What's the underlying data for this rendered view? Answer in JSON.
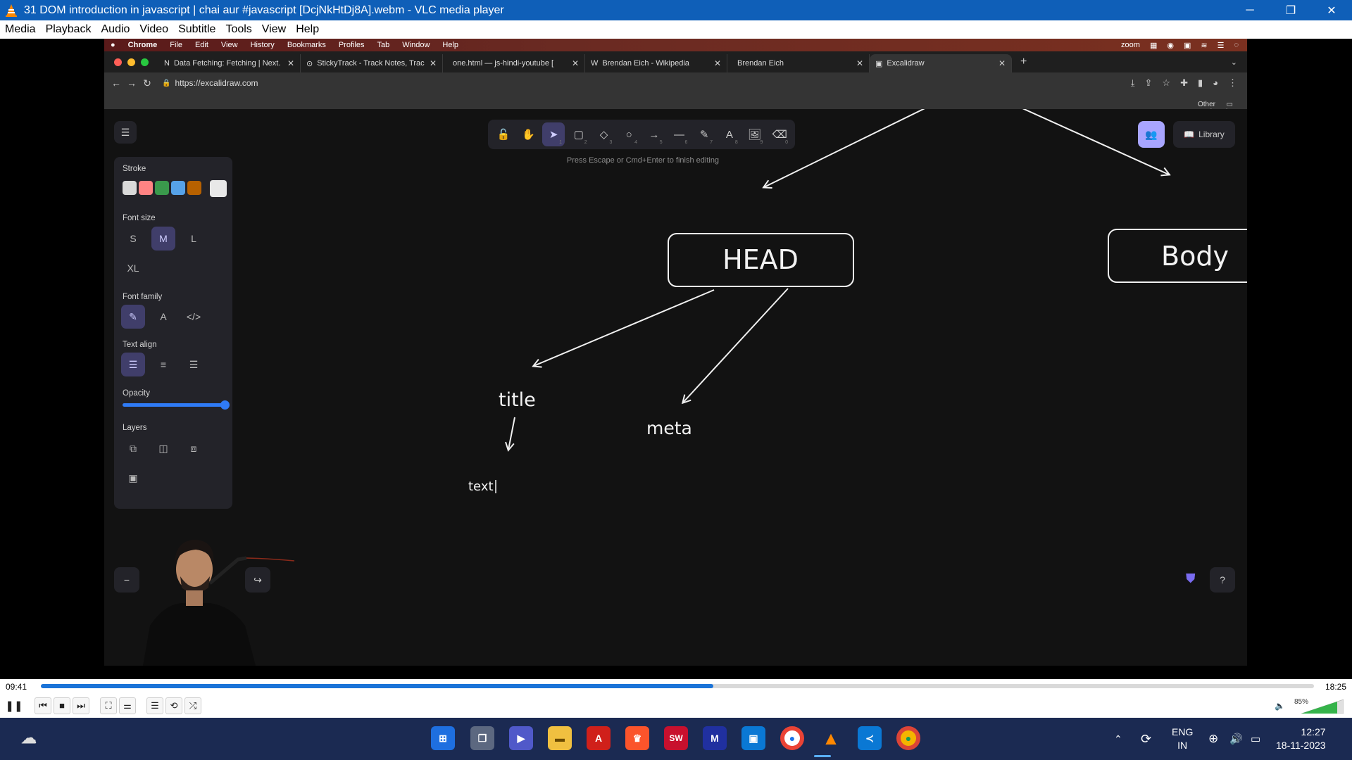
{
  "vlc": {
    "window_title": "31 DOM introduction in javascript  |  chai aur #javascript [DcjNkHtDj8A].webm - VLC media player",
    "menu": [
      "Media",
      "Playback",
      "Audio",
      "Video",
      "Subtitle",
      "Tools",
      "View",
      "Help"
    ],
    "elapsed": "09:41",
    "total": "18:25",
    "progress": 0.528,
    "volume_label": "85%",
    "volume": 0.85
  },
  "mac_menubar": {
    "app": "Chrome",
    "items": [
      "File",
      "Edit",
      "View",
      "History",
      "Bookmarks",
      "Profiles",
      "Tab",
      "Window",
      "Help"
    ],
    "right_app": "zoom"
  },
  "chrome": {
    "tabs": [
      {
        "label": "Data Fetching: Fetching | Next.",
        "favicon": "N",
        "active": false
      },
      {
        "label": "StickyTrack - Track Notes, Trac",
        "favicon": "⊙",
        "active": false
      },
      {
        "label": "one.html — js-hindi-youtube [",
        "favicon": "",
        "active": false
      },
      {
        "label": "Brendan Eich - Wikipedia",
        "favicon": "W",
        "active": false
      },
      {
        "label": "Brendan Eich",
        "favicon": "",
        "active": false
      },
      {
        "label": "Excalidraw",
        "favicon": "▣",
        "active": true
      }
    ],
    "url": "https://excalidraw.com",
    "bookmarks_label": "Other Bookmarks"
  },
  "excalidraw": {
    "hint": "Press Escape or Cmd+Enter to finish editing",
    "library_label": "Library",
    "tools": [
      {
        "name": "lock-tool",
        "icon": "🔓",
        "key": ""
      },
      {
        "name": "hand-tool",
        "icon": "✋",
        "key": ""
      },
      {
        "name": "selection-tool",
        "icon": "➤",
        "key": "1"
      },
      {
        "name": "rectangle-tool",
        "icon": "▢",
        "key": "2"
      },
      {
        "name": "diamond-tool",
        "icon": "◇",
        "key": "3"
      },
      {
        "name": "ellipse-tool",
        "icon": "○",
        "key": "4"
      },
      {
        "name": "arrow-tool",
        "icon": "→",
        "key": "5"
      },
      {
        "name": "line-tool",
        "icon": "—",
        "key": "6"
      },
      {
        "name": "draw-tool",
        "icon": "✎",
        "key": "7"
      },
      {
        "name": "text-tool",
        "icon": "A",
        "key": "8"
      },
      {
        "name": "image-tool",
        "icon": "🖼",
        "key": "9"
      },
      {
        "name": "eraser-tool",
        "icon": "⌫",
        "key": "0"
      }
    ],
    "selected_tool": "selection-tool",
    "panel": {
      "stroke_label": "Stroke",
      "stroke_colors": [
        "#d9d9d9",
        "#ff8383",
        "#3a994c",
        "#56a2e8",
        "#b76100"
      ],
      "stroke_current": "#e8e8e8",
      "font_size_label": "Font size",
      "font_sizes": [
        "S",
        "M",
        "L",
        "XL"
      ],
      "font_size_selected": "M",
      "font_family_label": "Font family",
      "text_align_label": "Text align",
      "opacity_label": "Opacity",
      "opacity": 1.0,
      "layers_label": "Layers"
    },
    "canvas": {
      "head_label": "HEAD",
      "body_label": "Body",
      "title_label": "title",
      "meta_label": "meta",
      "text_label": "text"
    }
  },
  "taskbar": {
    "apps": [
      "start",
      "task-view",
      "teams",
      "file-explorer",
      "acrobat",
      "brave",
      "solidworks",
      "vs-preview",
      "store",
      "chrome",
      "vlc",
      "vscode",
      "chrome-canary"
    ],
    "lang_1": "ENG",
    "lang_2": "IN",
    "time": "12:27",
    "date": "18-11-2023"
  }
}
